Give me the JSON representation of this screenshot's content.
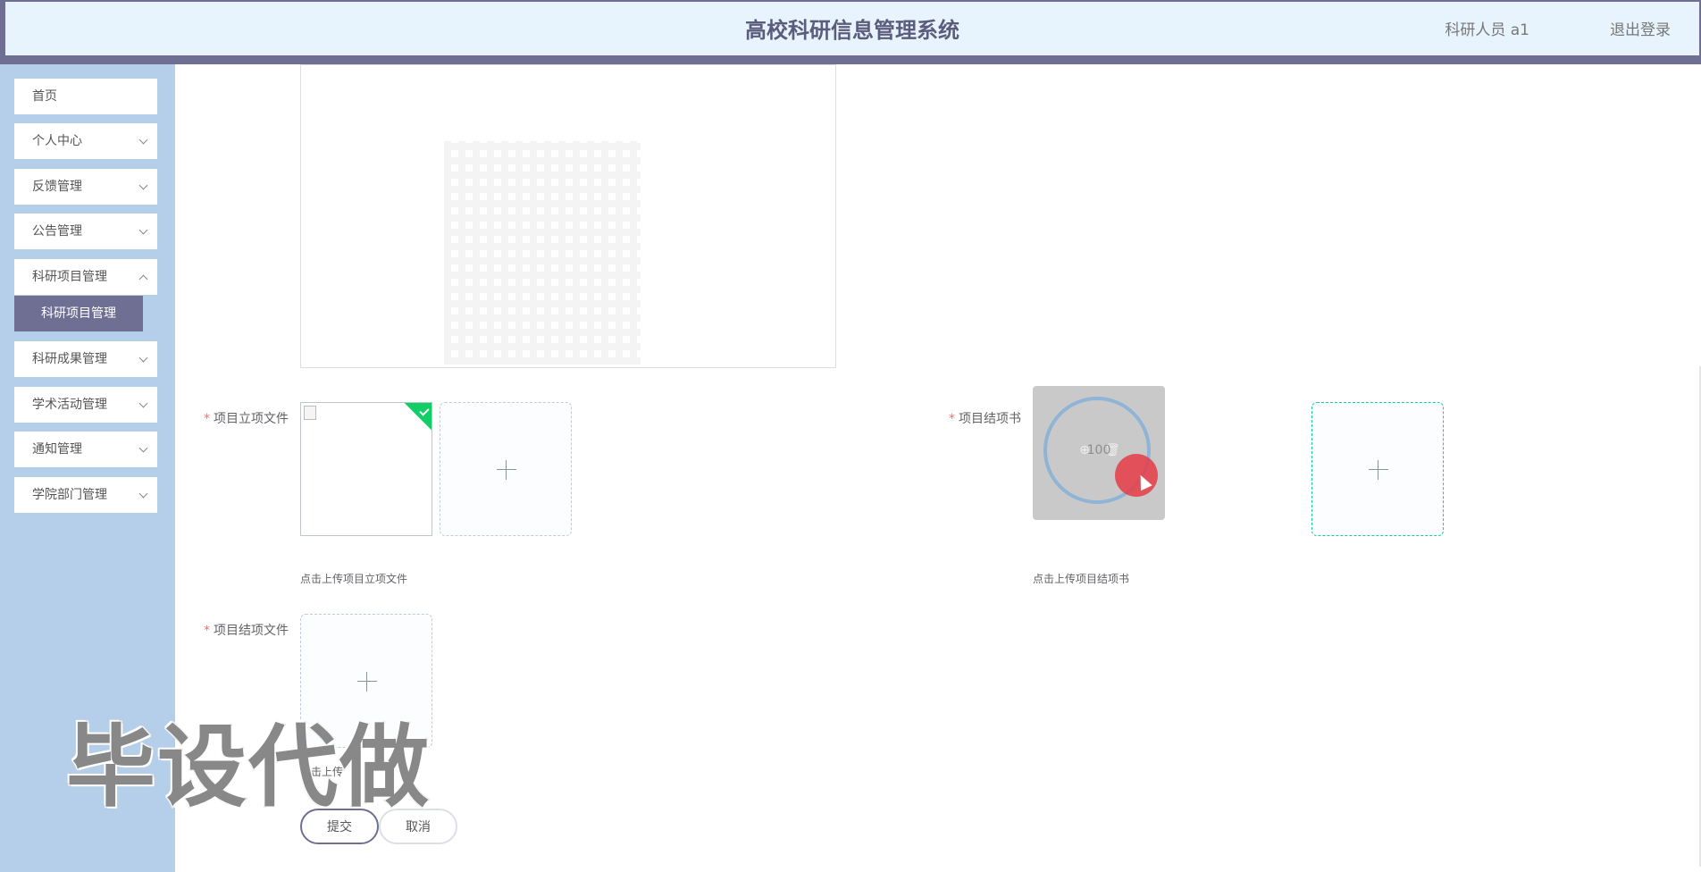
{
  "header": {
    "title": "高校科研信息管理系统",
    "user": "科研人员 a1",
    "logout": "退出登录"
  },
  "sidebar": {
    "items": [
      {
        "label": "首页"
      },
      {
        "label": "个人中心"
      },
      {
        "label": "反馈管理"
      },
      {
        "label": "公告管理"
      },
      {
        "label": "科研项目管理"
      },
      {
        "label": "科研成果管理"
      },
      {
        "label": "学术活动管理"
      },
      {
        "label": "通知管理"
      },
      {
        "label": "学院部门管理"
      }
    ],
    "active_submenu": "科研项目管理"
  },
  "form": {
    "field_lixiang": {
      "label": "项目立项文件",
      "tip": "点击上传项目立项文件",
      "status": "uploaded"
    },
    "field_jiexiangshu": {
      "label": "项目结项书",
      "tip": "点击上传项目结项书",
      "progress_text": "100"
    },
    "field_jiexiangwenjian": {
      "label": "项目结项文件",
      "tip": "点击上传"
    },
    "submit_label": "提交",
    "cancel_label": "取消"
  },
  "watermark": "毕设代做",
  "colors": {
    "header_bar": "#6f6f93",
    "header_bg": "#e8f4fd",
    "sidebar_bg": "#b5cfea",
    "active_menu": "#6f6f93",
    "success": "#13ce66",
    "required": "#f56c6c"
  }
}
